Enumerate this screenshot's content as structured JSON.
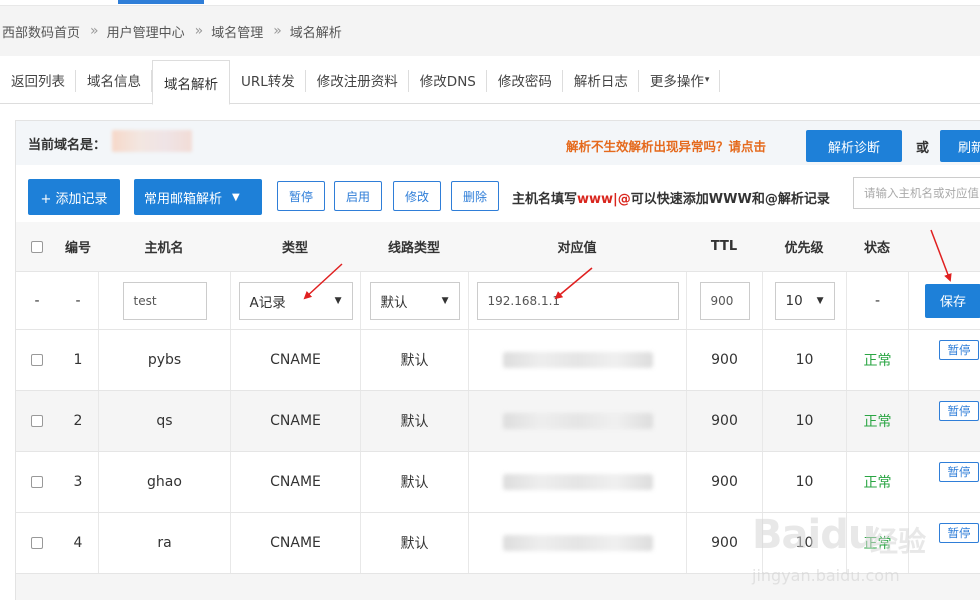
{
  "breadcrumb": [
    "西部数码首页",
    "用户管理中心",
    "域名管理",
    "域名解析"
  ],
  "tabs": [
    "返回列表",
    "域名信息",
    "域名解析",
    "URL转发",
    "修改注册资料",
    "修改DNS",
    "修改密码",
    "解析日志",
    "更多操作"
  ],
  "active_tab": "域名解析",
  "domain_info": {
    "label": "当前域名是：",
    "warning": "解析不生效解析出现异常吗？请点击",
    "diagnose_button": "解析诊断",
    "or": "或",
    "refresh_button": "刷新"
  },
  "toolbar": {
    "add_button": "+ 添加记录",
    "mail_button": "常用邮箱解析",
    "pause_button": "暂停",
    "enable_button": "启用",
    "modify_button": "修改",
    "delete_button": "删除",
    "hint_prefix": "主机名填写",
    "hint_red": "www|@",
    "hint_suffix": "可以快速添加WWW和@解析记录",
    "search_placeholder": "请输入主机名或对应值"
  },
  "table": {
    "headers": [
      "编号",
      "主机名",
      "类型",
      "线路类型",
      "对应值",
      "TTL",
      "优先级",
      "状态"
    ],
    "new_row": {
      "dash1": "-",
      "dash2": "-",
      "host": "test",
      "type": "A记录",
      "line": "默认",
      "value": "192.168.1.1",
      "ttl": "900",
      "priority": "10",
      "status": "-",
      "save_button": "保存"
    },
    "rows": [
      {
        "id": "1",
        "host": "pybs",
        "type": "CNAME",
        "line": "默认",
        "ttl": "900",
        "priority": "10",
        "status": "正常",
        "action": "暂停"
      },
      {
        "id": "2",
        "host": "qs",
        "type": "CNAME",
        "line": "默认",
        "ttl": "900",
        "priority": "10",
        "status": "正常",
        "action": "暂停"
      },
      {
        "id": "3",
        "host": "ghao",
        "type": "CNAME",
        "line": "默认",
        "ttl": "900",
        "priority": "10",
        "status": "正常",
        "action": "暂停"
      },
      {
        "id": "4",
        "host": "ra",
        "type": "CNAME",
        "line": "默认",
        "ttl": "900",
        "priority": "10",
        "status": "正常",
        "action": "暂停"
      }
    ]
  },
  "watermark": {
    "logo": "Baidu",
    "text": "经验",
    "url": "jingyan.baidu.com"
  },
  "colors": {
    "primary": "#1e80d8",
    "warning": "#e56a1d",
    "ok": "#2aa543",
    "annotation": "#e02020"
  }
}
